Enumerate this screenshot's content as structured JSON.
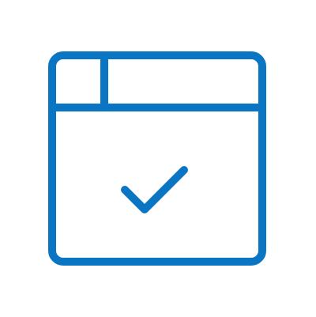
{
  "icon": {
    "name": "browser-window-check-icon",
    "stroke_color": "#0a75c2",
    "background_color": "#ffffff"
  }
}
